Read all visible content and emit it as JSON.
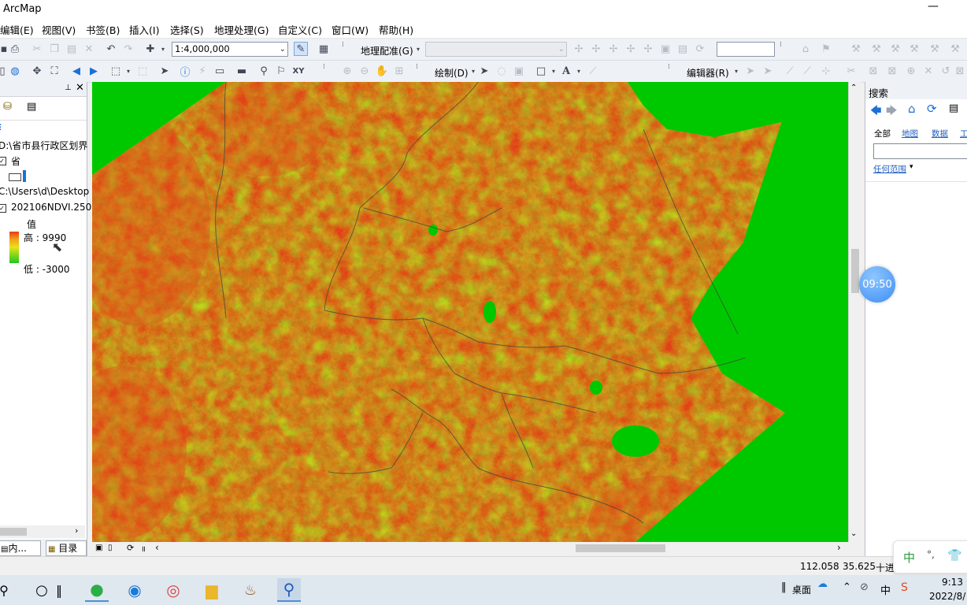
{
  "window": {
    "title": "ArcMap",
    "minimize_glyph": "—"
  },
  "menu": [
    "编辑(E)",
    "视图(V)",
    "书签(B)",
    "插入(I)",
    "选择(S)",
    "地理处理(G)",
    "自定义(C)",
    "窗口(W)",
    "帮助(H)"
  ],
  "toolbar": {
    "scale_value": "1:4,000,000",
    "georef_label": "地理配准(G)",
    "draw_label": "绘制(D)",
    "editor_label": "编辑器(R)",
    "font_glyph": "A"
  },
  "toc": {
    "layers": [
      {
        "label": "D:\\省市县行政区划界"
      },
      {
        "label": "省"
      },
      {
        "label": "C:\\Users\\d\\Desktop"
      },
      {
        "label": "202106NDVI.250"
      }
    ],
    "value_title": "值",
    "legend_high": "高 : 9990",
    "legend_low": "低 : -3000",
    "tabs": [
      "内...",
      "目录"
    ]
  },
  "search": {
    "title": "搜索",
    "filters": [
      "全部",
      "地图",
      "数据",
      "工"
    ],
    "range_label": "任何范围"
  },
  "status": {
    "x": "112.058",
    "y": "35.625",
    "unit": "十进"
  },
  "clock_bubble": "09:50",
  "ime": {
    "lang": "中",
    "punct": "°,"
  },
  "taskbar": {
    "desktop_label": "桌面",
    "ime_label": "中",
    "time": "9:13",
    "date": "2022/8/"
  },
  "colors": {
    "ndvi_high": "#e83b12",
    "ndvi_mid": "#e8e21a",
    "ndvi_low": "#22c81e",
    "background_green": "#00c800"
  }
}
